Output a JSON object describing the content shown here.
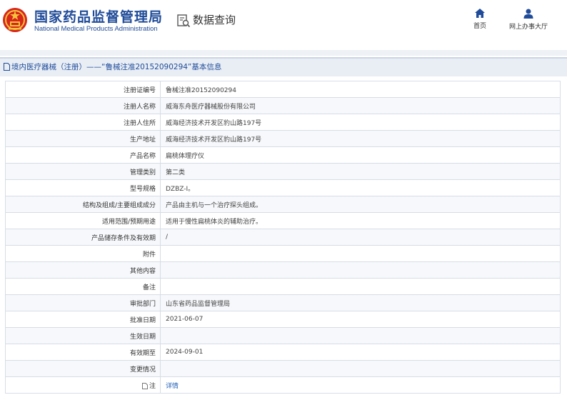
{
  "header": {
    "title_cn": "国家药品监督管理局",
    "title_en": "National Medical Products Administration",
    "query_title": "数据查询",
    "nav": {
      "home_label": "首页",
      "service_label": "网上办事大厅"
    },
    "colors": {
      "brand": "#1f4b99",
      "emblem_red": "#d7261b",
      "emblem_gold": "#f3c33b"
    },
    "icons": {
      "emblem": "national-emblem-icon",
      "query": "document-search-icon",
      "home": "home-icon",
      "service": "user-icon"
    }
  },
  "section": {
    "title": "境内医疗器械（注册）——“鲁械注准20152090294”基本信息",
    "icon": "document-icon"
  },
  "rows": [
    {
      "label": "注册证编号",
      "value": "鲁械注准20152090294"
    },
    {
      "label": "注册人名称",
      "value": "威海东舟医疗器械股份有限公司"
    },
    {
      "label": "注册人住所",
      "value": "威海经济技术开发区豹山路197号"
    },
    {
      "label": "生产地址",
      "value": "威海经济技术开发区豹山路197号"
    },
    {
      "label": "产品名称",
      "value": "扁桃体理疗仪"
    },
    {
      "label": "管理类别",
      "value": "第二类"
    },
    {
      "label": "型号规格",
      "value": "DZBZ-I。"
    },
    {
      "label": "结构及组成/主要组成成分",
      "value": "产品由主机与一个治疗探头组成。"
    },
    {
      "label": "适用范围/预期用途",
      "value": "适用于慢性扁桃体炎的辅助治疗。"
    },
    {
      "label": "产品储存条件及有效期",
      "value": "/"
    },
    {
      "label": "附件",
      "value": ""
    },
    {
      "label": "其他内容",
      "value": ""
    },
    {
      "label": "备注",
      "value": ""
    },
    {
      "label": "审批部门",
      "value": "山东省药品监督管理局"
    },
    {
      "label": "批准日期",
      "value": "2021-06-07"
    },
    {
      "label": "生效日期",
      "value": ""
    },
    {
      "label": "有效期至",
      "value": "2024-09-01"
    },
    {
      "label": "变更情况",
      "value": ""
    }
  ],
  "note_row": {
    "label": "注",
    "link_text": "详情",
    "icon": "note-icon"
  }
}
